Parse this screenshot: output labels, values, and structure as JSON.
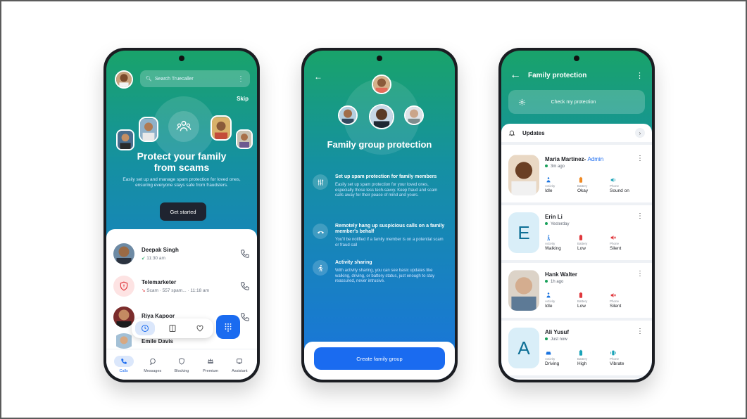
{
  "colors": {
    "accent": "#1a6bf0",
    "green": "#18a05a",
    "red": "#e0383d",
    "gradient_top": "#19a36a",
    "gradient_bottom": "#1a73df"
  },
  "phone1": {
    "search_placeholder": "Search Truecaller",
    "skip": "Skip",
    "title_line1": "Protect your family",
    "title_line2": "from scams",
    "description": "Easily set up and manage spam protection for loved ones, ensuring everyone stays safe from fraudsters.",
    "cta": "Get started",
    "calls": [
      {
        "name": "Deepak Singh",
        "sub": "11:30 am"
      },
      {
        "name": "Telemarketer",
        "sub": "Scam · 557 spam... · 11:18 am"
      },
      {
        "name": "Riya Kapoor",
        "sub": ""
      },
      {
        "name": "Emile Davis",
        "sub": ""
      }
    ],
    "nav": [
      "Calls",
      "Messages",
      "Blocking",
      "Premium",
      "Assistant"
    ]
  },
  "phone2": {
    "title": "Family group protection",
    "features": [
      {
        "heading": "Set up spam protection for family members",
        "desc": "Easily set up spam protection for your loved ones, especially those less tech-savvy. Keep fraud and scam calls away for their peace of mind and yours.",
        "icon": "sliders-icon"
      },
      {
        "heading": "Remotely hang up suspicious calls on a family member's behalf",
        "desc": "You'll be notified if a family member is on a potential scam or fraud call",
        "icon": "hang-up-icon"
      },
      {
        "heading": "Activity sharing",
        "desc": "With activity sharing, you can see basic updates like walking, driving, or battery status, just enough to stay reassured, never intrusive.",
        "icon": "walking-icon"
      }
    ],
    "cta": "Create family group"
  },
  "phone3": {
    "title": "Family protection",
    "check": "Check my protection",
    "updates": "Updates",
    "labels": {
      "activity": "Activity",
      "battery": "Battery",
      "phone": "Phone"
    },
    "admin_label": "Admin",
    "members": [
      {
        "name": "Maria Martinez",
        "admin": true,
        "time": "3m ago",
        "letter": "",
        "activity": "Idle",
        "battery": "Okay",
        "phone": "Sound on",
        "battery_color": "#f08a24",
        "phone_icon": "sound-on-icon"
      },
      {
        "name": "Erin Li",
        "admin": false,
        "time": "Yesterday",
        "letter": "E",
        "activity": "Walking",
        "battery": "Low",
        "phone": "Silent",
        "battery_color": "#e0383d",
        "phone_icon": "silent-icon"
      },
      {
        "name": "Hank Walter",
        "admin": false,
        "time": "1h ago",
        "letter": "",
        "activity": "Idle",
        "battery": "Low",
        "phone": "Silent",
        "battery_color": "#e0383d",
        "phone_icon": "silent-icon"
      },
      {
        "name": "Ali Yusuf",
        "admin": false,
        "time": "Just now",
        "letter": "A",
        "activity": "Driving",
        "battery": "High",
        "phone": "Vibrate",
        "battery_color": "#1aa3b8",
        "phone_icon": "vibrate-icon"
      }
    ]
  }
}
